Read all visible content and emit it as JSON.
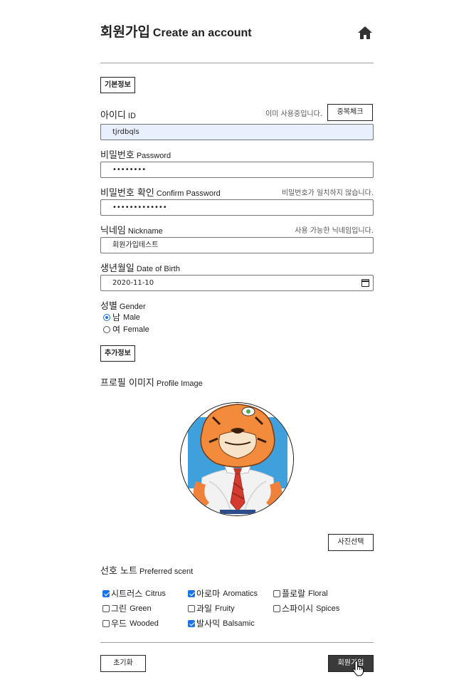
{
  "header": {
    "title_ko": "회원가입",
    "title_en": "Create an account",
    "home_icon": "home-icon"
  },
  "sections": {
    "basic": "기본정보",
    "extra": "추가정보"
  },
  "id_field": {
    "label_ko": "아이디",
    "label_en": "ID",
    "message": "이미 사용중입니다.",
    "check_button": "중복체크",
    "value": "tjrdbqls"
  },
  "password_field": {
    "label_ko": "비밀번호",
    "label_en": "Password",
    "value": "••••••••"
  },
  "confirm_field": {
    "label_ko": "비밀번호 확인",
    "label_en": "Confirm Password",
    "message": "비밀번호가 일치하지 않습니다.",
    "value": "•••••••••••••"
  },
  "nickname_field": {
    "label_ko": "닉네임",
    "label_en": "Nickname",
    "message": "사용 가능한 닉네임입니다.",
    "value": "회원가입테스트"
  },
  "birth_field": {
    "label_ko": "생년월일",
    "label_en": "Date of Birth",
    "value": "2020-11-10",
    "icon": "calendar-icon"
  },
  "gender": {
    "label_ko": "성별",
    "label_en": "Gender",
    "options": [
      {
        "ko": "남",
        "en": "Male",
        "checked": true
      },
      {
        "ko": "여",
        "en": "Female",
        "checked": false
      }
    ]
  },
  "profile": {
    "label_ko": "프로필 이미지",
    "label_en": "Profile Image",
    "select_button": "사진선택"
  },
  "scent": {
    "label_ko": "선호 노트",
    "label_en": "Preferred scent",
    "options": [
      {
        "ko": "시트러스",
        "en": "Citrus",
        "checked": true
      },
      {
        "ko": "아로마",
        "en": "Aromatics",
        "checked": true
      },
      {
        "ko": "플로랄",
        "en": "Floral",
        "checked": false
      },
      {
        "ko": "그린",
        "en": "Green",
        "checked": false
      },
      {
        "ko": "과일",
        "en": "Fruity",
        "checked": false
      },
      {
        "ko": "스파이시",
        "en": "Spices",
        "checked": false
      },
      {
        "ko": "우드",
        "en": "Wooded",
        "checked": false
      },
      {
        "ko": "발사믹",
        "en": "Balsamic",
        "checked": true
      }
    ]
  },
  "footer": {
    "reset_button": "초기화",
    "submit_button": "회원가입"
  },
  "colors": {
    "accent": "#1a73e8",
    "autofill": "#e8f0fe",
    "submit_bg": "#3a3a3a"
  }
}
